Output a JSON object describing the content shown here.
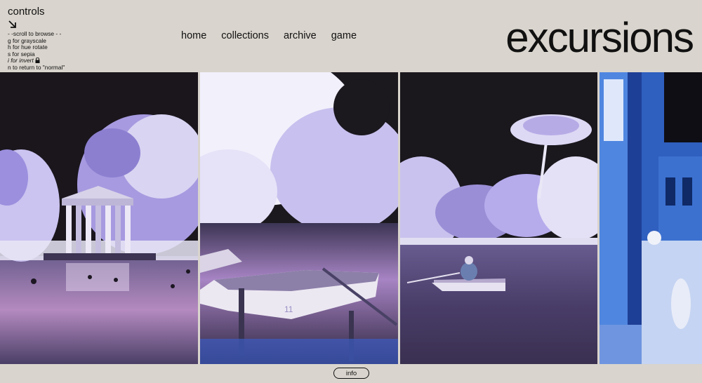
{
  "controls": {
    "title": "controls",
    "lines": [
      "- -scroll to browse - -",
      "g for grayscale",
      "h for hue rotate",
      "s for sepia",
      "i for invert",
      "n to return to \"normal\""
    ]
  },
  "nav": {
    "home": "home",
    "collections": "collections",
    "archive": "archive",
    "game": "game"
  },
  "brand": "excursions",
  "info_label": "info",
  "colors": {
    "background": "#d9d4cd",
    "text": "#111111",
    "sky": "#17141a",
    "foliage": "#8f86d8",
    "water": "#5c4f7a"
  },
  "icons": {
    "controls_arrow": "arrow-down-right-icon",
    "invert_lock": "lock-icon"
  }
}
